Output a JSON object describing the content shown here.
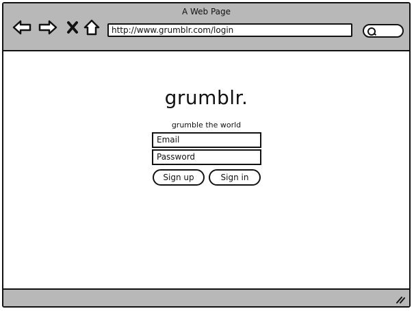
{
  "window": {
    "title": "A Web Page"
  },
  "toolbar": {
    "back_icon": "back-arrow-icon",
    "forward_icon": "forward-arrow-icon",
    "stop_icon": "close-icon",
    "home_icon": "home-icon",
    "url": "http://www.grumblr.com/login",
    "search_icon": "search-icon"
  },
  "login": {
    "logo": "grumblr.",
    "tagline": "grumble the world",
    "email_placeholder": "Email",
    "password_placeholder": "Password",
    "signup_label": "Sign up",
    "signin_label": "Sign in"
  },
  "colors": {
    "chrome": "#b8b8b8",
    "ink": "#111111",
    "background": "#ffffff"
  }
}
